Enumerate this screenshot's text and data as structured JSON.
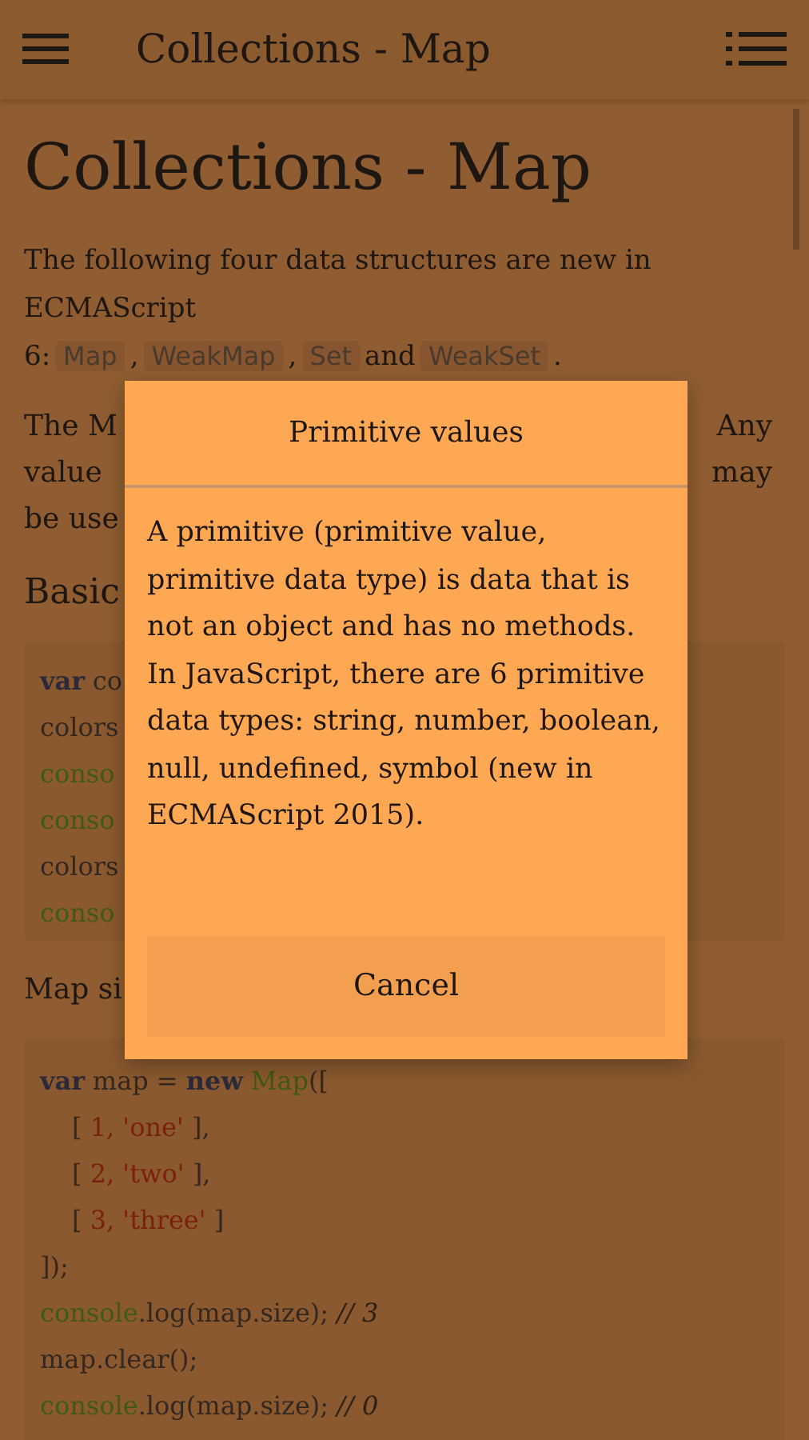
{
  "app_bar": {
    "title": "Collections - Map"
  },
  "article": {
    "heading": "Collections - Map",
    "intro": [
      {
        "kind": "text",
        "text": "The following four data structures are new in ECMAScript 6:"
      },
      {
        "kind": "code",
        "text": "Map"
      },
      {
        "kind": "text",
        "text": ","
      },
      {
        "kind": "code",
        "text": "WeakMap"
      },
      {
        "kind": "text",
        "text": ","
      },
      {
        "kind": "code",
        "text": "Set"
      },
      {
        "kind": "text",
        "text": "and"
      },
      {
        "kind": "code",
        "text": "WeakSet"
      },
      {
        "kind": "text",
        "text": "."
      }
    ],
    "partial_lines": [
      {
        "left": "The M",
        "right": "Any"
      },
      {
        "left": "value",
        "right": "may"
      },
      {
        "left": "be use"
      }
    ],
    "section_heading": "Basic",
    "code_block_1": [
      [
        {
          "kind": "keyword",
          "text": "var"
        },
        {
          "kind": "plain",
          "text": "co"
        }
      ],
      [
        {
          "kind": "plain",
          "text": "colors"
        }
      ],
      [
        {
          "kind": "call",
          "text": "conso"
        }
      ],
      [
        {
          "kind": "call",
          "text": "conso"
        }
      ],
      [
        {
          "kind": "plain",
          "text": "colors"
        }
      ],
      [
        {
          "kind": "call",
          "text": "conso"
        }
      ]
    ],
    "after_code": "Map si",
    "code_block_2": [
      {
        "tokens": [
          {
            "kind": "keyword",
            "text": "var"
          },
          {
            "kind": "plain",
            "text": "map = "
          },
          {
            "kind": "keyword",
            "text": "new"
          },
          {
            "kind": "call",
            "text": "Map"
          },
          {
            "kind": "plain",
            "text": "(["
          }
        ],
        "children": [
          {
            "tokens": [
              {
                "kind": "plain",
                "text": "[ "
              },
              {
                "kind": "literal",
                "text": "1, 'one'"
              },
              {
                "kind": "plain",
                "text": " ],"
              }
            ]
          },
          {
            "tokens": [
              {
                "kind": "plain",
                "text": "[ "
              },
              {
                "kind": "literal",
                "text": "2, 'two'"
              },
              {
                "kind": "plain",
                "text": " ],"
              }
            ]
          },
          {
            "tokens": [
              {
                "kind": "plain",
                "text": "[ "
              },
              {
                "kind": "literal",
                "text": "3, 'three'"
              },
              {
                "kind": "plain",
                "text": " ]"
              }
            ]
          }
        ]
      },
      {
        "tokens": [
          {
            "kind": "plain",
            "text": "]);"
          }
        ]
      },
      {
        "tokens": [
          {
            "kind": "call",
            "text": "console"
          },
          {
            "kind": "plain",
            "text": ".log(map.size); "
          },
          {
            "kind": "comment",
            "text": "// 3"
          }
        ]
      },
      {
        "tokens": [
          {
            "kind": "plain",
            "text": "map.clear();"
          }
        ]
      },
      {
        "tokens": [
          {
            "kind": "call",
            "text": "console"
          },
          {
            "kind": "plain",
            "text": ".log(map.size); "
          },
          {
            "kind": "comment",
            "text": "// 0"
          }
        ]
      }
    ]
  },
  "dialog": {
    "title": "Primitive values",
    "body": "A primitive (primitive value, primitive data type) is data that is not an object and has no methods. In JavaScript, there are 6 primitive data types: string, number, boolean, null, undefined, symbol (new in ECMAScript 2015).",
    "button": "Cancel"
  }
}
